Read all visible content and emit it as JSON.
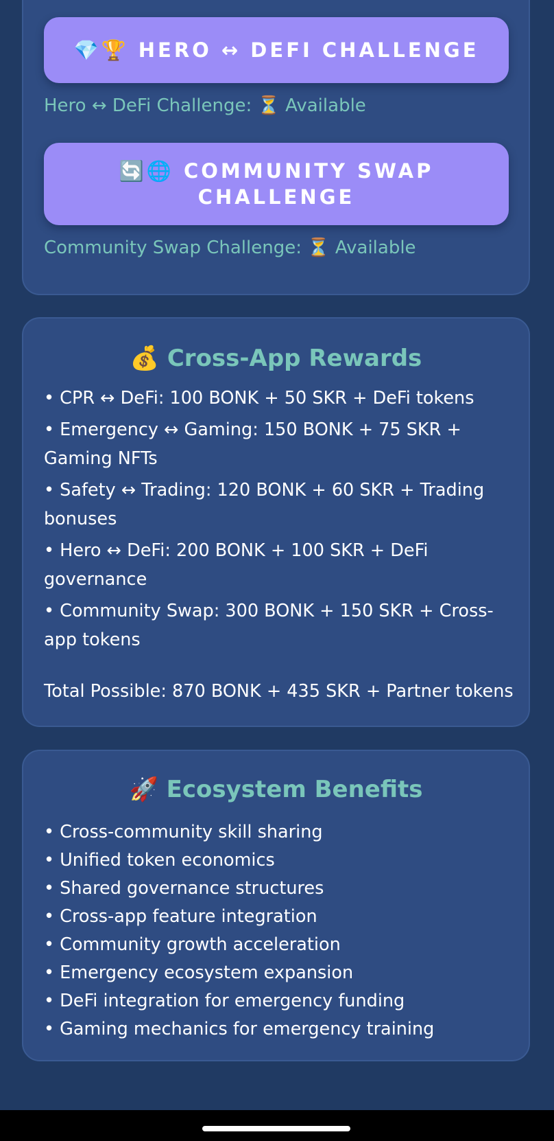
{
  "challenges": [
    {
      "button_label": "💎🏆 HERO ↔ DEFI CHALLENGE",
      "status": "Hero ↔ DeFi Challenge: ⏳ Available"
    },
    {
      "button_label": "🔄🌐 COMMUNITY SWAP CHALLENGE",
      "status": "Community Swap Challenge: ⏳ Available"
    }
  ],
  "rewards": {
    "title": "💰 Cross-App Rewards",
    "items": [
      "• CPR ↔ DeFi: 100 BONK + 50 SKR + DeFi tokens",
      "• Emergency ↔ Gaming: 150 BONK + 75 SKR + Gaming NFTs",
      "• Safety ↔ Trading: 120 BONK + 60 SKR + Trading bonuses",
      "• Hero ↔ DeFi: 200 BONK + 100 SKR + DeFi governance",
      "• Community Swap: 300 BONK + 150 SKR + Cross-app tokens"
    ],
    "total": "Total Possible: 870 BONK + 435 SKR + Partner tokens"
  },
  "benefits": {
    "title": "🚀 Ecosystem Benefits",
    "items": [
      "• Cross-community skill sharing",
      "• Unified token economics",
      "• Shared governance structures",
      "• Cross-app feature integration",
      "• Community growth acceleration",
      "• Emergency ecosystem expansion",
      "• DeFi integration for emergency funding",
      "• Gaming mechanics for emergency training"
    ]
  },
  "colors": {
    "background": "#203a63",
    "card": "#2f4c82",
    "button": "#9b8cf7",
    "accent_text": "#7ac6ba"
  }
}
